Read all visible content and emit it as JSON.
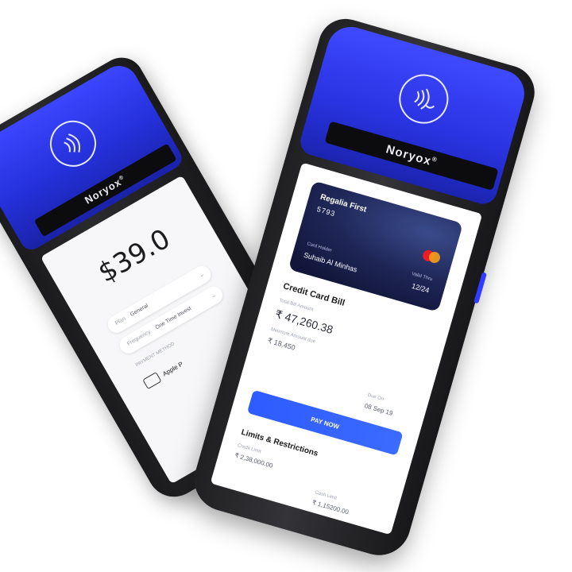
{
  "brand": {
    "name": "Noryox",
    "mark": "®"
  },
  "colors": {
    "accent": "#2e3dff",
    "pay_button": "#2e5bff",
    "card": "#1e2656"
  },
  "left_screen": {
    "amount": "$39.0",
    "fields": [
      {
        "key": "Plan",
        "value": "General"
      },
      {
        "key": "Frequency",
        "value": "One Time Invest"
      }
    ],
    "section_label": "PAYMENT METHOD",
    "payment_option": "Apple P"
  },
  "right_screen": {
    "card": {
      "name": "Regalia First",
      "number": "5793",
      "holder_label": "Card Holder",
      "holder": "Suhaib Al Minhas",
      "valid_label": "Valid Thru",
      "valid": "12/24",
      "network_icon": "mastercard-icon"
    },
    "bill": {
      "title": "Credit Card Bill",
      "total_label": "Total Bill Amount",
      "total": "₹ 47,260.38",
      "minimum_label": "Minimum Amount due",
      "minimum": "₹ 18,450",
      "due_label": "Due On",
      "due_date": "08 Sep 19",
      "pay_label": "PAY NOW"
    },
    "limits": {
      "title": "Limits & Restrictions",
      "credit_label": "Credit Limit",
      "credit": "₹ 2,38,000.00",
      "cash_label": "Cash Limit",
      "cash": "₹ 1,15200.00"
    }
  }
}
